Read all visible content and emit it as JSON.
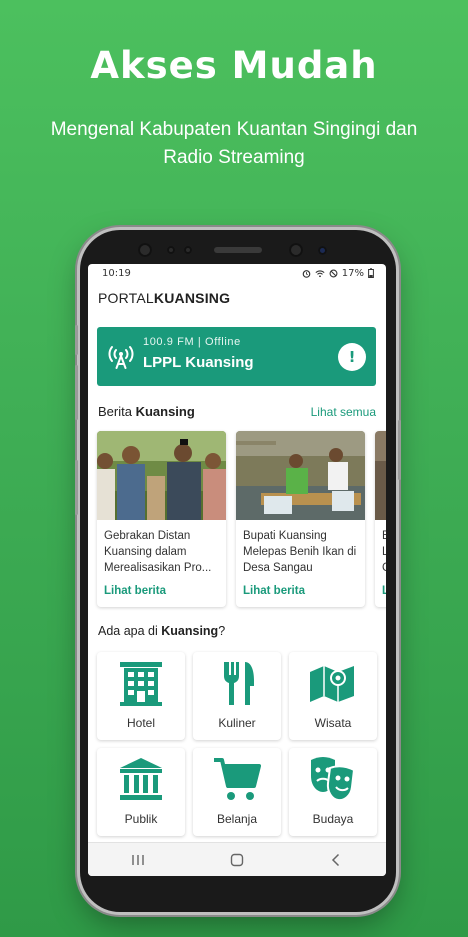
{
  "promo": {
    "headline": "Akses Mudah",
    "subline": "Mengenal Kabupaten Kuantan Singingi dan Radio Streaming"
  },
  "status_bar": {
    "time": "10:19",
    "battery": "17%"
  },
  "app": {
    "logo_light": "PORTAL",
    "logo_bold": "KUANSING"
  },
  "radio": {
    "frequency": "100.9 FM | Offline",
    "station": "LPPL Kuansing",
    "alert_symbol": "!"
  },
  "news_section": {
    "title_prefix": "Berita ",
    "title_bold": "Kuansing",
    "see_all": "Lihat semua",
    "items": [
      {
        "title": "Gebrakan Distan Kuansing dalam Merealisasikan Pro...",
        "link": "Lihat berita"
      },
      {
        "title": "Bupati Kuansing Melepas Benih Ikan di Desa Sangau",
        "link": "Lihat berita"
      },
      {
        "title": "B L G",
        "link": "L"
      }
    ]
  },
  "category_section": {
    "prefix": "Ada apa di ",
    "bold": "Kuansing",
    "suffix": "?",
    "items": [
      {
        "label": "Hotel",
        "icon": "hotel-icon"
      },
      {
        "label": "Kuliner",
        "icon": "fork-knife-icon"
      },
      {
        "label": "Wisata",
        "icon": "map-icon"
      },
      {
        "label": "Publik",
        "icon": "public-building-icon"
      },
      {
        "label": "Belanja",
        "icon": "shopping-cart-icon"
      },
      {
        "label": "Budaya",
        "icon": "theater-masks-icon"
      }
    ]
  },
  "colors": {
    "background_green": "#3fae55",
    "accent_teal": "#1a9a7b"
  }
}
